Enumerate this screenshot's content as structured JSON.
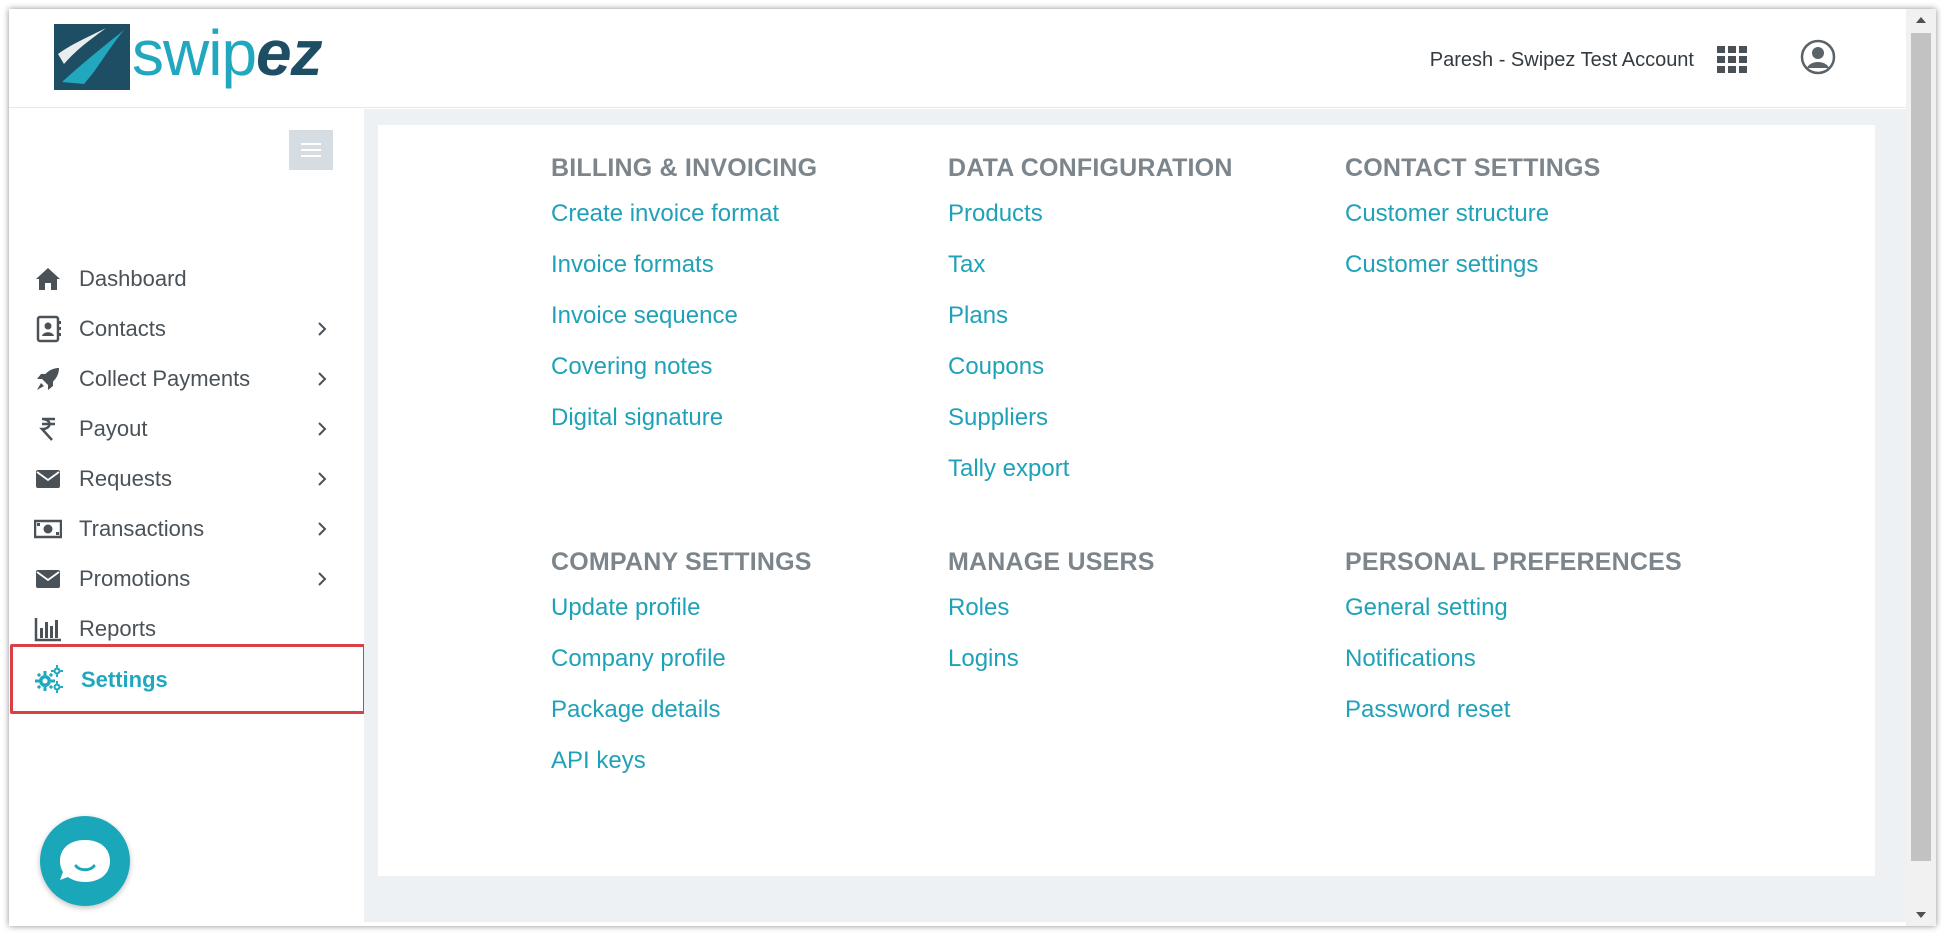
{
  "header": {
    "brand_main": "swip",
    "brand_accent": "ez",
    "account_name": "Paresh - Swipez Test Account",
    "apps_icon": "grid-icon",
    "user_icon": "user-circle-icon"
  },
  "sidebar": {
    "items": [
      {
        "label": "Dashboard",
        "icon": "home-icon",
        "has_submenu": false
      },
      {
        "label": "Contacts",
        "icon": "contact-book-icon",
        "has_submenu": true
      },
      {
        "label": "Collect Payments",
        "icon": "rocket-icon",
        "has_submenu": true
      },
      {
        "label": "Payout",
        "icon": "rupee-icon",
        "has_submenu": true
      },
      {
        "label": "Requests",
        "icon": "envelope-icon",
        "has_submenu": true
      },
      {
        "label": "Transactions",
        "icon": "money-icon",
        "has_submenu": true
      },
      {
        "label": "Promotions",
        "icon": "envelope-icon",
        "has_submenu": true
      },
      {
        "label": "Reports",
        "icon": "bar-chart-icon",
        "has_submenu": false
      },
      {
        "label": "Settings",
        "icon": "gears-icon",
        "has_submenu": false,
        "active": true
      }
    ]
  },
  "settings": {
    "billing": {
      "title": "BILLING & INVOICING",
      "links": [
        "Create invoice format",
        "Invoice formats",
        "Invoice sequence",
        "Covering notes",
        "Digital signature"
      ]
    },
    "data": {
      "title": "DATA CONFIGURATION",
      "links": [
        "Products",
        "Tax",
        "Plans",
        "Coupons",
        "Suppliers",
        "Tally export"
      ]
    },
    "contact": {
      "title": "CONTACT SETTINGS",
      "links": [
        "Customer structure",
        "Customer settings"
      ]
    },
    "company": {
      "title": "COMPANY SETTINGS",
      "links": [
        "Update profile",
        "Company profile",
        "Package details",
        "API keys"
      ]
    },
    "users": {
      "title": "MANAGE USERS",
      "links": [
        "Roles",
        "Logins"
      ]
    },
    "personal": {
      "title": "PERSONAL PREFERENCES",
      "links": [
        "General setting",
        "Notifications",
        "Password reset"
      ]
    }
  },
  "colors": {
    "accent": "#22a8be",
    "brand_dark": "#1e4e63",
    "highlight_border": "#d94046",
    "section_title": "#7b858b"
  }
}
